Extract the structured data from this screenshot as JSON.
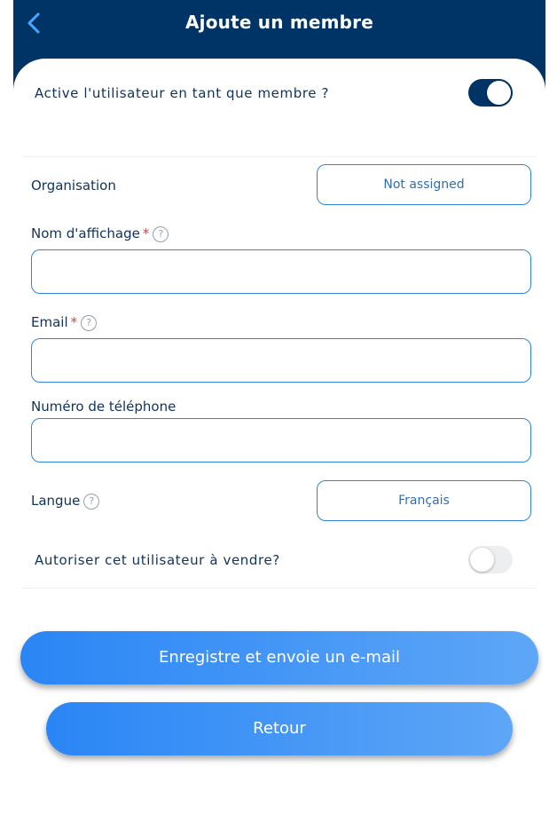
{
  "header": {
    "title": "Ajoute un membre",
    "back_icon": "chevron-left-icon"
  },
  "form": {
    "active_member": {
      "label": "Active l'utilisateur en tant que membre ?",
      "enabled": true
    },
    "organisation": {
      "label": "Organisation",
      "value": "Not assigned"
    },
    "display_name": {
      "label": "Nom d'affichage",
      "required_mark": "*",
      "help": "?",
      "value": ""
    },
    "email": {
      "label": "Email",
      "required_mark": "*",
      "help": "?",
      "value": ""
    },
    "phone": {
      "label": "Numéro de téléphone",
      "value": ""
    },
    "language": {
      "label": "Langue",
      "help": "?",
      "value": "Français"
    },
    "allow_sell": {
      "label": "Autoriser cet utilisateur à vendre?",
      "enabled": false
    }
  },
  "actions": {
    "save_label": "Enregistre et envoie un e-mail",
    "back_label": "Retour"
  },
  "colors": {
    "header_bg": "#003366",
    "accent": "#2f86d6",
    "button_gradient_start": "#2a86f5",
    "button_gradient_end": "#5ea6f7",
    "required": "#e0413a"
  }
}
